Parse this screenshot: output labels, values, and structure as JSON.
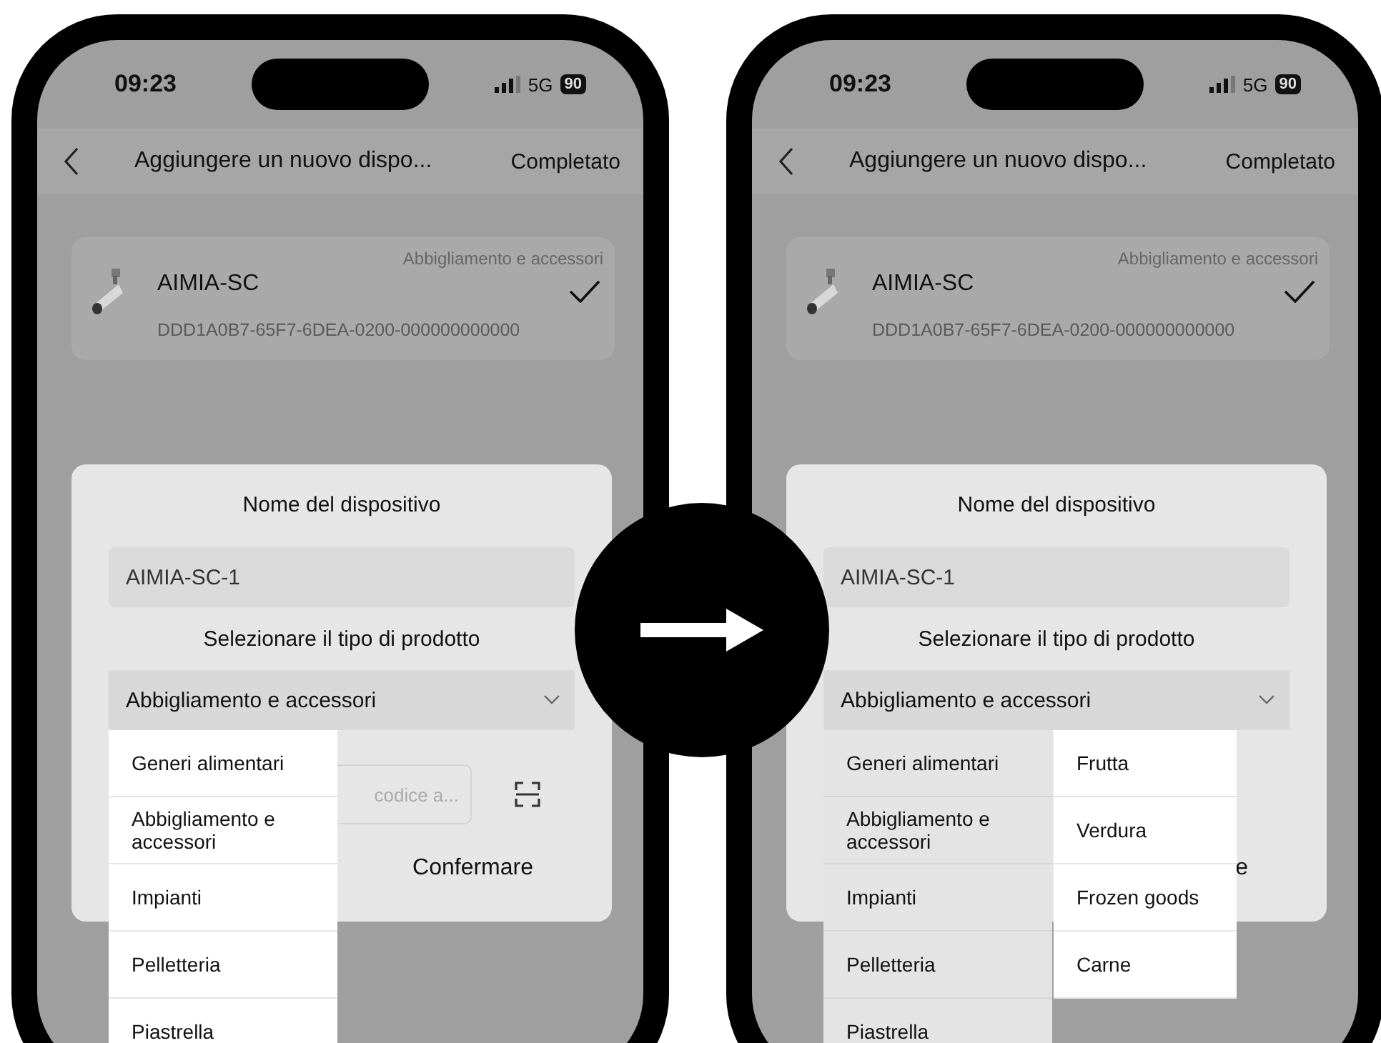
{
  "phones": [
    {
      "status": {
        "time": "09:23",
        "network": "5G",
        "battery": "90"
      },
      "header": {
        "title": "Aggiungere un nuovo dispo...",
        "action": "Completato"
      },
      "device": {
        "name": "AIMIA-SC",
        "category": "Abbigliamento e accessori",
        "id": "DDD1A0B7-65F7-6DEA-0200-000000000000",
        "checked": true
      },
      "dialog": {
        "title": "Nome del dispositivo",
        "name_value": "AIMIA-SC-1",
        "type_label": "Selezionare il tipo di prodotto",
        "type_value": "Abbigliamento e accessori",
        "barcode_placeholder": "codice a...",
        "confirm": "Confermare",
        "menu": {
          "dimmed": false,
          "items": [
            "Generi alimentari",
            "Abbigliamento e accessori",
            "Impianti",
            "Pelletteria",
            "Piastrella"
          ]
        }
      }
    },
    {
      "status": {
        "time": "09:23",
        "network": "5G",
        "battery": "90"
      },
      "header": {
        "title": "Aggiungere un nuovo dispo...",
        "action": "Completato"
      },
      "device": {
        "name": "AIMIA-SC",
        "category": "Abbigliamento e accessori",
        "id": "DDD1A0B7-65F7-6DEA-0200-000000000000",
        "checked": true
      },
      "dialog": {
        "title": "Nome del dispositivo",
        "name_value": "AIMIA-SC-1",
        "type_label": "Selezionare il tipo di prodotto",
        "type_value": "Abbigliamento e accessori",
        "confirm": "e",
        "menu": {
          "dimmed": true,
          "items": [
            "Generi alimentari",
            "Abbigliamento e accessori",
            "Impianti",
            "Pelletteria",
            "Piastrella"
          ],
          "submenu": [
            "Frutta",
            "Verdura",
            "Frozen goods",
            "Carne"
          ]
        }
      }
    }
  ]
}
